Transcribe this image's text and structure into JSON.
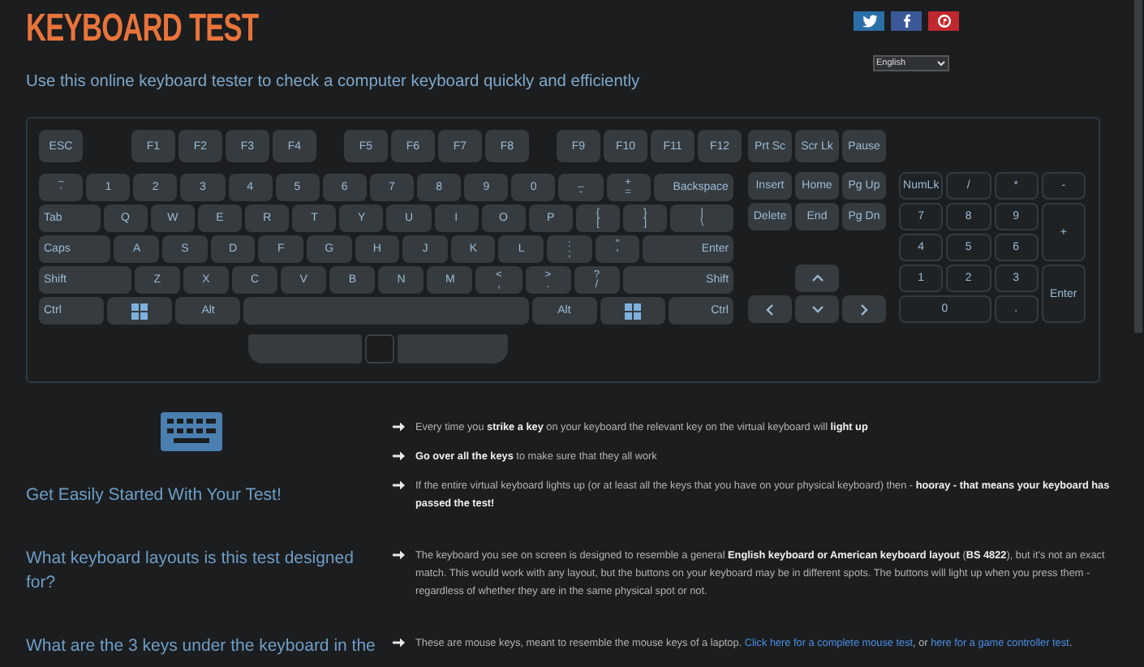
{
  "header": {
    "title": "KEYBOARD TEST",
    "social": [
      {
        "kind": "twitter",
        "color": "#2a6fa8"
      },
      {
        "kind": "facebook",
        "color": "#3b5998"
      },
      {
        "kind": "pinterest",
        "color": "#c0282f"
      }
    ],
    "language_select": {
      "value": "English"
    },
    "subtitle": "Use this online keyboard tester to check a computer keyboard quickly and efficiently"
  },
  "keyboard": {
    "function_row": [
      [
        "ESC"
      ],
      [
        "F1",
        "F2",
        "F3",
        "F4"
      ],
      [
        "F5",
        "F6",
        "F7",
        "F8"
      ],
      [
        "F9",
        "F10",
        "F11",
        "F12"
      ]
    ],
    "main_rows": [
      [
        {
          "kind": "dual",
          "top": "~",
          "bottom": "`"
        },
        {
          "kind": "text",
          "label": "1"
        },
        {
          "kind": "text",
          "label": "2"
        },
        {
          "kind": "text",
          "label": "3"
        },
        {
          "kind": "text",
          "label": "4"
        },
        {
          "kind": "text",
          "label": "5"
        },
        {
          "kind": "text",
          "label": "6"
        },
        {
          "kind": "text",
          "label": "7"
        },
        {
          "kind": "text",
          "label": "8"
        },
        {
          "kind": "text",
          "label": "9"
        },
        {
          "kind": "text",
          "label": "0"
        },
        {
          "kind": "dual",
          "top": "_",
          "bottom": "-"
        },
        {
          "kind": "dual",
          "top": "+",
          "bottom": "="
        },
        {
          "kind": "text",
          "label": "Backspace"
        }
      ],
      [
        {
          "kind": "text",
          "label": "Tab"
        },
        {
          "kind": "text",
          "label": "Q"
        },
        {
          "kind": "text",
          "label": "W"
        },
        {
          "kind": "text",
          "label": "E"
        },
        {
          "kind": "text",
          "label": "R"
        },
        {
          "kind": "text",
          "label": "T"
        },
        {
          "kind": "text",
          "label": "Y"
        },
        {
          "kind": "text",
          "label": "U"
        },
        {
          "kind": "text",
          "label": "I"
        },
        {
          "kind": "text",
          "label": "O"
        },
        {
          "kind": "text",
          "label": "P"
        },
        {
          "kind": "dual",
          "top": "{",
          "bottom": "["
        },
        {
          "kind": "dual",
          "top": "}",
          "bottom": "]"
        },
        {
          "kind": "dual",
          "top": "|",
          "bottom": "\\"
        }
      ],
      [
        {
          "kind": "text",
          "label": "Caps"
        },
        {
          "kind": "text",
          "label": "A"
        },
        {
          "kind": "text",
          "label": "S"
        },
        {
          "kind": "text",
          "label": "D"
        },
        {
          "kind": "text",
          "label": "F"
        },
        {
          "kind": "text",
          "label": "G"
        },
        {
          "kind": "text",
          "label": "H"
        },
        {
          "kind": "text",
          "label": "J"
        },
        {
          "kind": "text",
          "label": "K"
        },
        {
          "kind": "text",
          "label": "L"
        },
        {
          "kind": "dual",
          "top": ":",
          "bottom": ";"
        },
        {
          "kind": "dual",
          "top": "\"",
          "bottom": "'"
        },
        {
          "kind": "text",
          "label": "Enter"
        }
      ],
      [
        {
          "kind": "text",
          "label": "Shift"
        },
        {
          "kind": "text",
          "label": "Z"
        },
        {
          "kind": "text",
          "label": "X"
        },
        {
          "kind": "text",
          "label": "C"
        },
        {
          "kind": "text",
          "label": "V"
        },
        {
          "kind": "text",
          "label": "B"
        },
        {
          "kind": "text",
          "label": "N"
        },
        {
          "kind": "text",
          "label": "M"
        },
        {
          "kind": "dual",
          "top": "<",
          "bottom": ","
        },
        {
          "kind": "dual",
          "top": ">",
          "bottom": "."
        },
        {
          "kind": "dual",
          "top": "?",
          "bottom": "/"
        },
        {
          "kind": "text",
          "label": "Shift"
        }
      ],
      [
        {
          "kind": "text",
          "label": "Ctrl"
        },
        {
          "kind": "windows"
        },
        {
          "kind": "text",
          "label": "Alt"
        },
        {
          "kind": "space"
        },
        {
          "kind": "text",
          "label": "Alt"
        },
        {
          "kind": "windows"
        },
        {
          "kind": "text",
          "label": "Ctrl"
        }
      ]
    ],
    "system_keys": [
      "Prt Sc",
      "Scr Lk",
      "Pause"
    ],
    "nav_keys": [
      "Insert",
      "Home",
      "Pg Up",
      "Delete",
      "End",
      "Pg Dn"
    ],
    "arrow_keys": [
      {
        "kind": "up"
      },
      {
        "kind": "left"
      },
      {
        "kind": "down"
      },
      {
        "kind": "right"
      }
    ],
    "numpad": [
      "NumLk",
      "/",
      "*",
      "-",
      "7",
      "8",
      "9",
      "+",
      "4",
      "5",
      "6",
      "1",
      "2",
      "3",
      "Enter",
      "0",
      "."
    ]
  },
  "sections": [
    {
      "has_icon": true,
      "heading": "Get Easily Started With Your Test!",
      "bullets": [
        [
          {
            "kind": "text",
            "text": "Every time you **strike a key** on your keyboard the relevant key on the virtual keyboard will **light up**"
          }
        ],
        [
          {
            "kind": "text",
            "text": "**Go over all the keys** to make sure that they all work"
          }
        ],
        [
          {
            "kind": "text",
            "text": "If the entire virtual keyboard lights up (or at least all the keys that you have on your physical keyboard) then - **hooray - that means your keyboard has passed the test!**"
          }
        ]
      ]
    },
    {
      "has_icon": false,
      "heading": "What keyboard layouts is this test designed for?",
      "bullets": [
        [
          {
            "kind": "text",
            "text": "The keyboard you see on screen is designed to resemble a general **English keyboard or American keyboard layout** (**BS 4822**), but it's not an exact match. This would work with any layout, but the buttons on your keyboard may be in different spots. The buttons will light up when you press them - regardless of whether they are in the same physical spot or not."
          }
        ]
      ]
    },
    {
      "has_icon": false,
      "heading": "What are the 3 keys under the keyboard in the",
      "bullets": [
        [
          {
            "kind": "text",
            "text": "These are mouse keys, meant to resemble the mouse keys of a laptop. "
          },
          {
            "kind": "link",
            "text": "Click here for a complete mouse test"
          },
          {
            "kind": "text",
            "text": ", or "
          },
          {
            "kind": "link",
            "text": "here for a game controller test"
          },
          {
            "kind": "text",
            "text": "."
          }
        ]
      ]
    }
  ]
}
